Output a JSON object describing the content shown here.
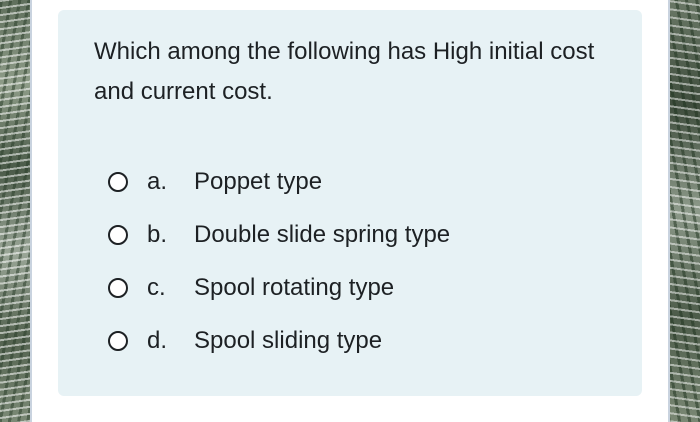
{
  "question": {
    "text": "Which among the following has High initial cost and current cost."
  },
  "options": [
    {
      "letter": "a.",
      "text": "Poppet type"
    },
    {
      "letter": "b.",
      "text": "Double slide spring type"
    },
    {
      "letter": "c.",
      "text": "Spool rotating type"
    },
    {
      "letter": "d.",
      "text": "Spool sliding type"
    }
  ],
  "colors": {
    "card_background": "#e7f2f5",
    "text": "#1d2124"
  }
}
